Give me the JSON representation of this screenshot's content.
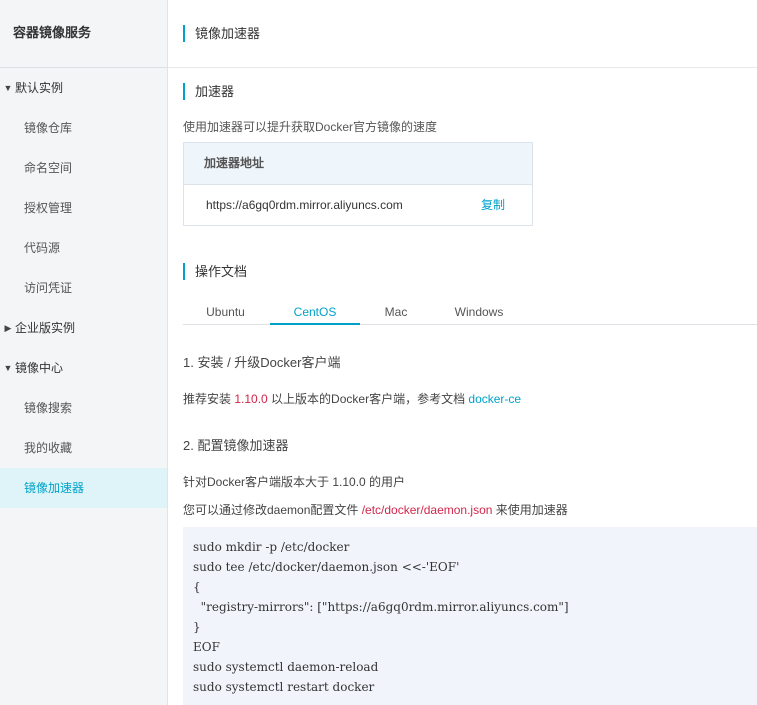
{
  "sidebar": {
    "title": "容器镜像服务",
    "groups": [
      {
        "label": "默认实例",
        "expanded": true,
        "items": [
          "镜像仓库",
          "命名空间",
          "授权管理",
          "代码源",
          "访问凭证"
        ]
      },
      {
        "label": "企业版实例",
        "expanded": false,
        "items": []
      },
      {
        "label": "镜像中心",
        "expanded": true,
        "items": [
          "镜像搜索",
          "我的收藏",
          "镜像加速器"
        ]
      }
    ],
    "active_item": "镜像加速器"
  },
  "page": {
    "title": "镜像加速器"
  },
  "accelerator": {
    "section_title": "加速器",
    "description": "使用加速器可以提升获取Docker官方镜像的速度",
    "box_header": "加速器地址",
    "address": "https://a6gq0rdm.mirror.aliyuncs.com",
    "copy_label": "复制"
  },
  "docs": {
    "section_title": "操作文档",
    "tabs": [
      "Ubuntu",
      "CentOS",
      "Mac",
      "Windows"
    ],
    "active_tab": "CentOS",
    "step1": {
      "title": "1. 安装 / 升级Docker客户端",
      "text_before": "推荐安装 ",
      "version": "1.10.0",
      "text_after": " 以上版本的Docker客户端，参考文档 ",
      "link": "docker-ce"
    },
    "step2": {
      "title": "2. 配置镜像加速器",
      "line1": "针对Docker客户端版本大于 1.10.0 的用户",
      "line2_before": "您可以通过修改daemon配置文件 ",
      "config_path": "/etc/docker/daemon.json",
      "line2_after": " 来使用加速器"
    },
    "code_lines": [
      "sudo mkdir -p /etc/docker",
      "sudo tee /etc/docker/daemon.json <<-'EOF'",
      "{",
      "  \"registry-mirrors\": [\"https://a6gq0rdm.mirror.aliyuncs.com\"]",
      "}",
      "EOF",
      "sudo systemctl daemon-reload",
      "sudo systemctl restart docker"
    ]
  },
  "colors": {
    "accent": "#00a2ca",
    "highlight_red": "#d0264a",
    "sidebar_bg": "#f4f5f7",
    "active_item_bg": "#dff4f8",
    "code_bg": "#f1f5fb"
  }
}
